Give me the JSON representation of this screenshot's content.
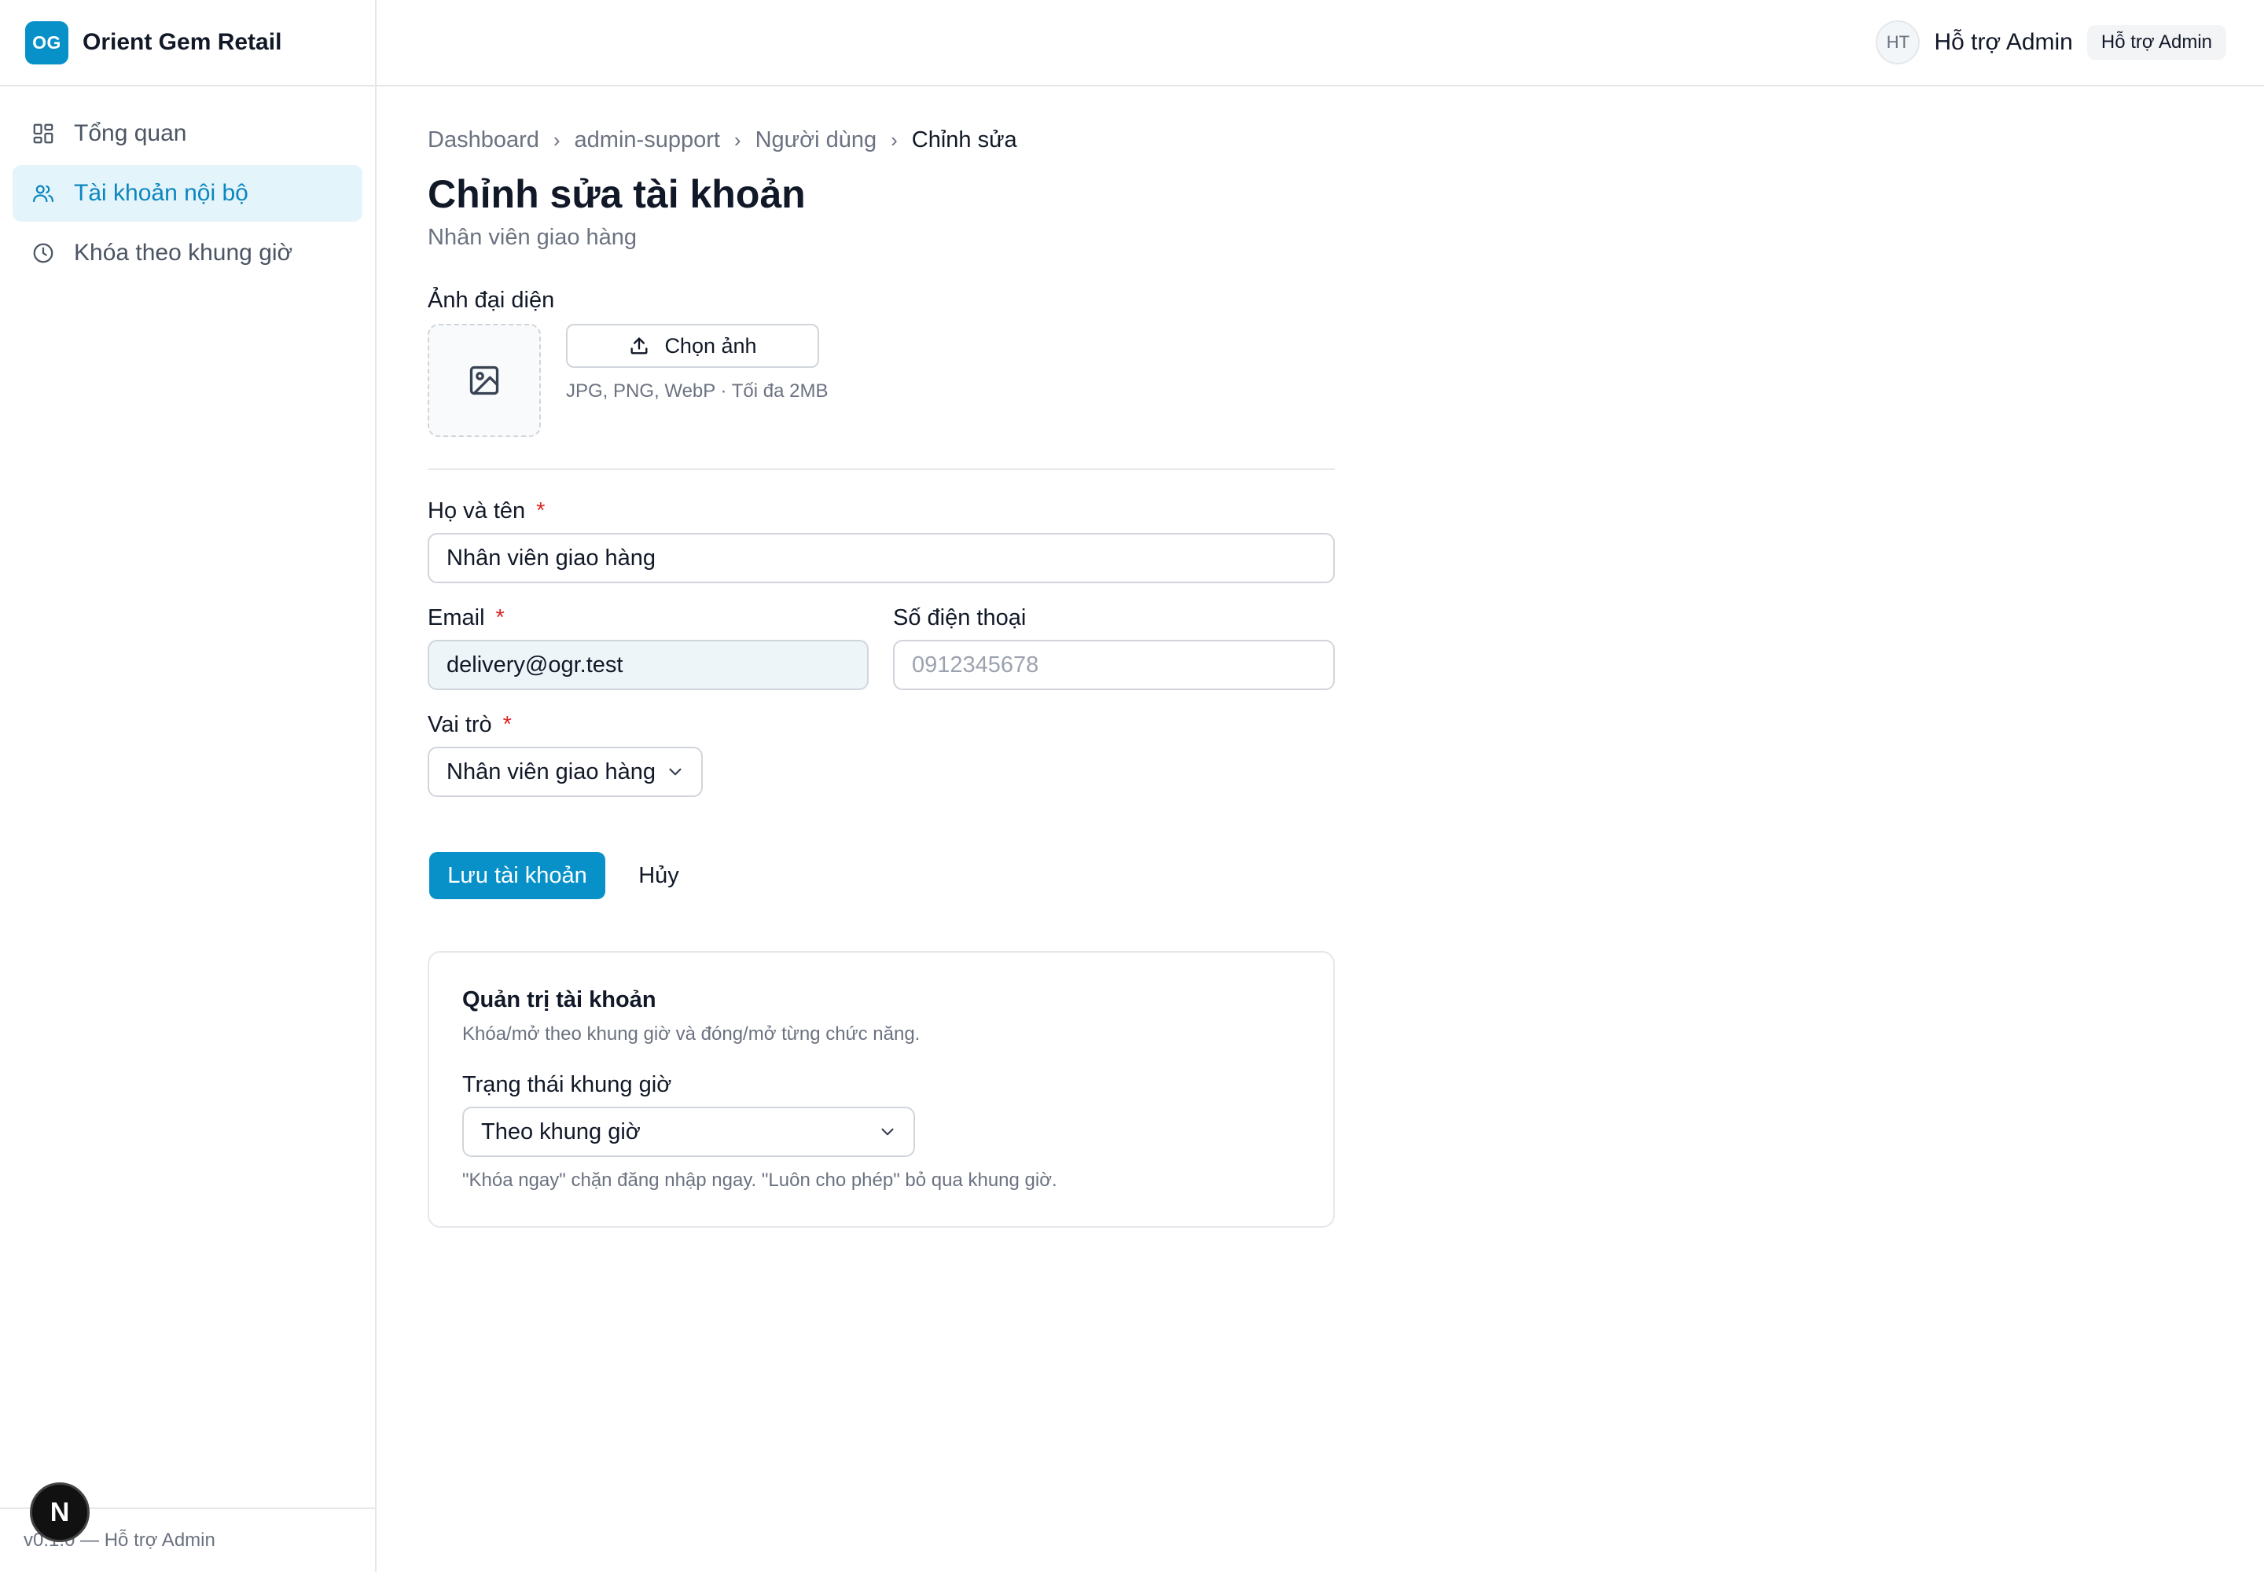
{
  "brand": {
    "logo_text": "OG",
    "name": "Orient Gem Retail"
  },
  "sidebar": {
    "items": [
      {
        "label": "Tổng quan",
        "icon": "dashboard-grid-icon",
        "active": false
      },
      {
        "label": "Tài khoản nội bộ",
        "icon": "users-icon",
        "active": true
      },
      {
        "label": "Khóa theo khung giờ",
        "icon": "clock-icon",
        "active": false
      }
    ],
    "footer": "v0.1.0 — Hỗ trợ Admin"
  },
  "topbar": {
    "avatar_initials": "HT",
    "user_name": "Hỗ trợ Admin",
    "role_badge": "Hỗ trợ Admin"
  },
  "breadcrumb": [
    "Dashboard",
    "admin-support",
    "Người dùng",
    "Chỉnh sửa"
  ],
  "page": {
    "title": "Chỉnh sửa tài khoản",
    "subtitle": "Nhân viên giao hàng"
  },
  "avatar_section": {
    "label": "Ảnh đại diện",
    "upload_label": "Chọn ảnh",
    "hint": "JPG, PNG, WebP · Tối đa 2MB"
  },
  "form": {
    "full_name": {
      "label": "Họ và tên",
      "required_mark": "*",
      "value": "Nhân viên giao hàng"
    },
    "email": {
      "label": "Email",
      "required_mark": "*",
      "value": "delivery@ogr.test"
    },
    "phone": {
      "label": "Số điện thoại",
      "placeholder": "0912345678"
    },
    "role": {
      "label": "Vai trò",
      "required_mark": "*",
      "value": "Nhân viên giao hàng"
    },
    "save_label": "Lưu tài khoản",
    "cancel_label": "Hủy"
  },
  "admin_card": {
    "title": "Quản trị tài khoản",
    "description": "Khóa/mở theo khung giờ và đóng/mở từng chức năng.",
    "status_label": "Trạng thái khung giờ",
    "status_value": "Theo khung giờ",
    "hint": "\"Khóa ngay\" chặn đăng nhập ngay. \"Luôn cho phép\" bỏ qua khung giờ."
  },
  "colors": {
    "accent": "#0891c9",
    "active_bg": "#e4f4fb",
    "required": "#dc2626"
  }
}
